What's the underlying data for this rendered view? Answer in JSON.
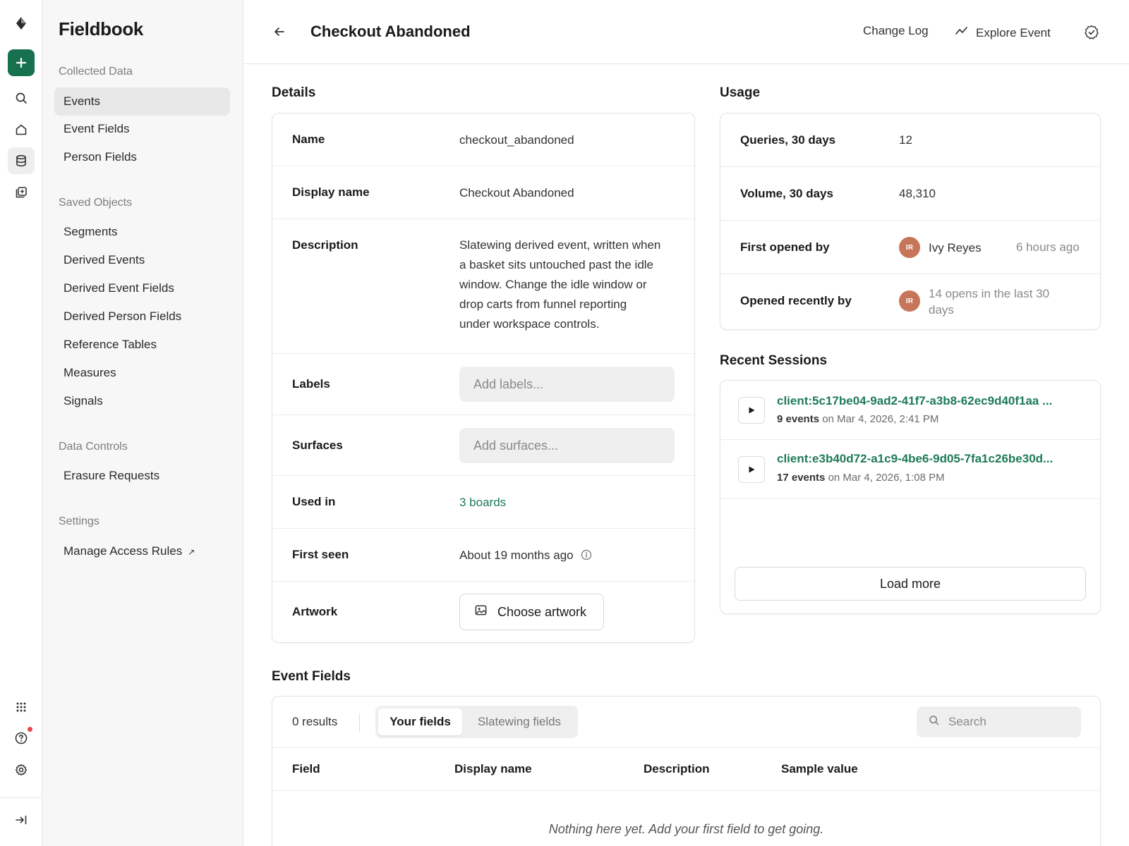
{
  "app": {
    "name": "Fieldbook"
  },
  "sidebar": {
    "sections": [
      {
        "title": "Collected Data",
        "items": [
          {
            "label": "Events",
            "active": true
          },
          {
            "label": "Event Fields"
          },
          {
            "label": "Person Fields"
          }
        ]
      },
      {
        "title": "Saved Objects",
        "items": [
          {
            "label": "Segments"
          },
          {
            "label": "Derived Events"
          },
          {
            "label": "Derived Event Fields"
          },
          {
            "label": "Derived Person Fields"
          },
          {
            "label": "Reference Tables"
          },
          {
            "label": "Measures"
          },
          {
            "label": "Signals"
          }
        ]
      },
      {
        "title": "Data Controls",
        "items": [
          {
            "label": "Erasure Requests"
          }
        ]
      },
      {
        "title": "Settings",
        "items": [
          {
            "label": "Manage Access Rules",
            "external": true
          }
        ]
      }
    ]
  },
  "header": {
    "title": "Checkout Abandoned",
    "change_log": "Change Log",
    "explore_event": "Explore Event"
  },
  "details": {
    "title": "Details",
    "name_label": "Name",
    "name_value": "checkout_abandoned",
    "display_name_label": "Display name",
    "display_name_value": "Checkout Abandoned",
    "description_label": "Description",
    "description_lines": [
      "Slatewing derived event, written when",
      "a basket sits untouched past the idle",
      "window. Change the idle window or",
      "drop carts from funnel reporting",
      "under workspace controls."
    ],
    "labels_label": "Labels",
    "labels_placeholder": "Add labels...",
    "surfaces_label": "Surfaces",
    "surfaces_placeholder": "Add surfaces...",
    "used_in_label": "Used in",
    "used_in_value": "3 boards",
    "first_seen_label": "First seen",
    "first_seen_value": "About 19 months ago",
    "artwork_label": "Artwork",
    "artwork_button": "Choose artwork"
  },
  "usage": {
    "title": "Usage",
    "queries_label": "Queries, 30 days",
    "queries_value": "12",
    "volume_label": "Volume, 30 days",
    "volume_value": "48,310",
    "first_opened_label": "First opened by",
    "first_opened_initials": "IR",
    "first_opened_name": "Ivy Reyes",
    "first_opened_time": "6 hours ago",
    "opened_recently_label": "Opened recently by",
    "opened_recently_initials": "IR",
    "opened_recently_line1": "14 opens in the last 30",
    "opened_recently_line2": "days"
  },
  "sessions": {
    "title": "Recent Sessions",
    "items": [
      {
        "id": "client:5c17be04-9ad2-41f7-a3b8-62ec9d40f1aa ...",
        "count": "9 events",
        "when": "on Mar 4, 2026, 2:41 PM"
      },
      {
        "id": "client:e3b40d72-a1c9-4be6-9d05-7fa1c26be30d...",
        "count": "17 events",
        "when": "on Mar 4, 2026, 1:08 PM"
      }
    ],
    "load_more": "Load more"
  },
  "event_fields": {
    "title": "Event Fields",
    "results": "0 results",
    "tab_yours": "Your fields",
    "tab_slatewing": "Slatewing fields",
    "search_placeholder": "Search",
    "columns": [
      "Field",
      "Display name",
      "Description",
      "Sample value"
    ],
    "empty": "Nothing here yet. Add your first field to get going."
  },
  "colors": {
    "accent": "#17714f",
    "link": "#1e7b57",
    "avatar": "#c77559",
    "notification": "#e5484d"
  },
  "icons": [
    "logo-icon",
    "plus-icon",
    "search-icon",
    "home-icon",
    "database-icon",
    "library-icon",
    "apps-grid-icon",
    "help-icon",
    "settings-icon",
    "collapse-icon",
    "back-arrow-icon",
    "trend-icon",
    "verified-badge-icon",
    "info-icon",
    "image-icon",
    "play-icon",
    "external-arrow-icon"
  ]
}
